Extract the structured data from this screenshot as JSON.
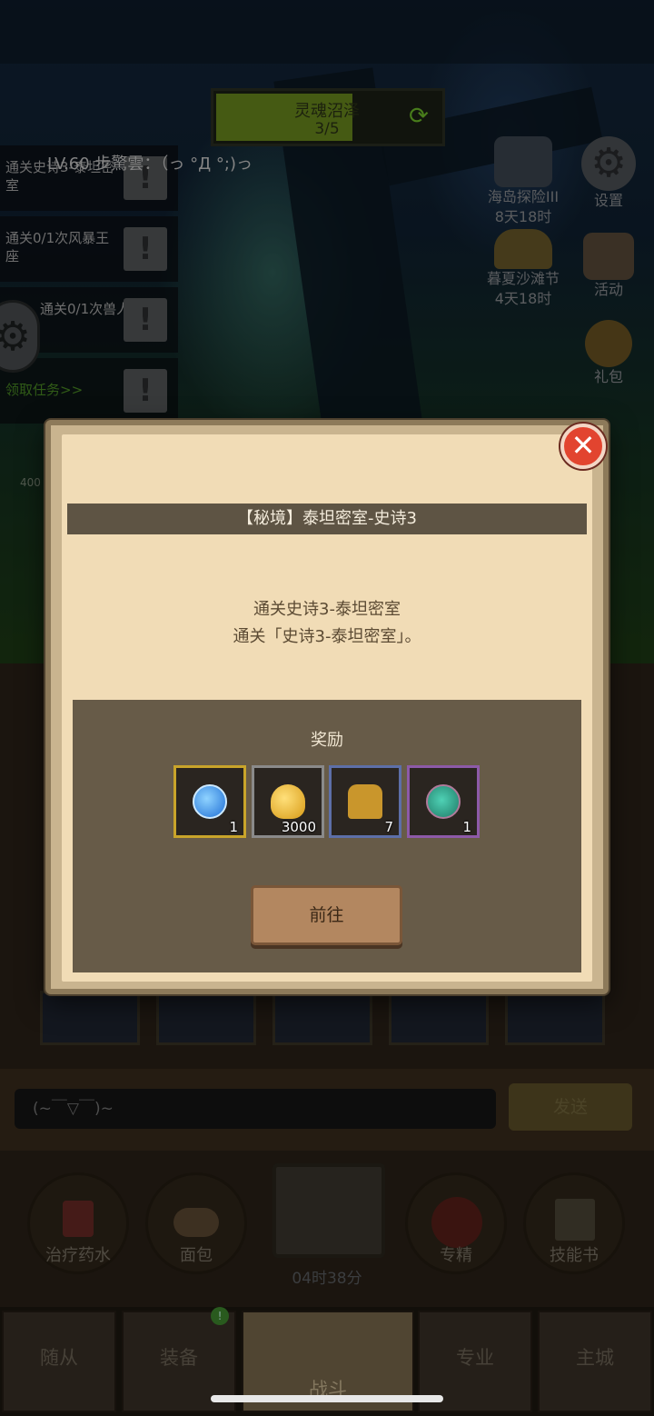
{
  "zone_banner": {
    "name": "灵魂沼泽",
    "progress_text": "3/5",
    "refresh_icon": "refresh-icon"
  },
  "level_line": "LV.60  步驚雲：（っ °Д °;)っ",
  "quests": [
    {
      "text": "通关史诗3-泰坦密室",
      "icon": "exclamation-icon"
    },
    {
      "text": "通关0/1次风暴王座",
      "icon": "exclamation-icon"
    },
    {
      "text": "通关0/1次兽人城",
      "icon": "exclamation-icon"
    },
    {
      "text": "",
      "icon": "exclamation-icon"
    }
  ],
  "quest_link": "领取任务>>",
  "side_events": [
    {
      "label": "海岛探险III",
      "sub": "8天18时",
      "icon": "anchor-icon"
    },
    {
      "label": "设置",
      "sub": "",
      "icon": "gear-icon"
    },
    {
      "label": "暮夏沙滩节",
      "sub": "4天18时",
      "icon": "beach-hat-icon"
    },
    {
      "label": "活动",
      "sub": "",
      "icon": "scroll-icon"
    },
    {
      "label": "礼包",
      "sub": "",
      "icon": "gift-icon"
    }
  ],
  "hero_level": "400",
  "chat": {
    "placeholder": "(~￣▽￣)~",
    "send_label": "发送"
  },
  "consumables": [
    {
      "label": "治疗药水",
      "icon": "potion-icon"
    },
    {
      "label": "面包",
      "icon": "bread-icon"
    },
    {
      "label": "专精",
      "icon": "specialization-icon"
    },
    {
      "label": "技能书",
      "icon": "skill-book-icon"
    }
  ],
  "chest_timer": "04时38分",
  "tabs": [
    {
      "label": "随从"
    },
    {
      "label": "装备"
    },
    {
      "label": "战斗"
    },
    {
      "label": "专业"
    },
    {
      "label": "主城"
    }
  ],
  "tab_badge": "!",
  "modal": {
    "title": "【秘境】泰坦密室-史诗3",
    "quest_name": "通关史诗3-泰坦密室",
    "quest_desc": "通关「史诗3-泰坦密室」。",
    "reward_title": "奖励",
    "rewards": [
      {
        "icon": "blue-token-icon",
        "count": "1",
        "border": "#c9a42a"
      },
      {
        "icon": "gold-coin-icon",
        "count": "3000",
        "border": "#8a8a8a"
      },
      {
        "icon": "horned-helmet-icon",
        "count": "7",
        "border": "#5d6fa8"
      },
      {
        "icon": "teal-gem-icon",
        "count": "1",
        "border": "#8d5aa8"
      }
    ],
    "go_label": "前往",
    "close_icon": "close-icon"
  }
}
